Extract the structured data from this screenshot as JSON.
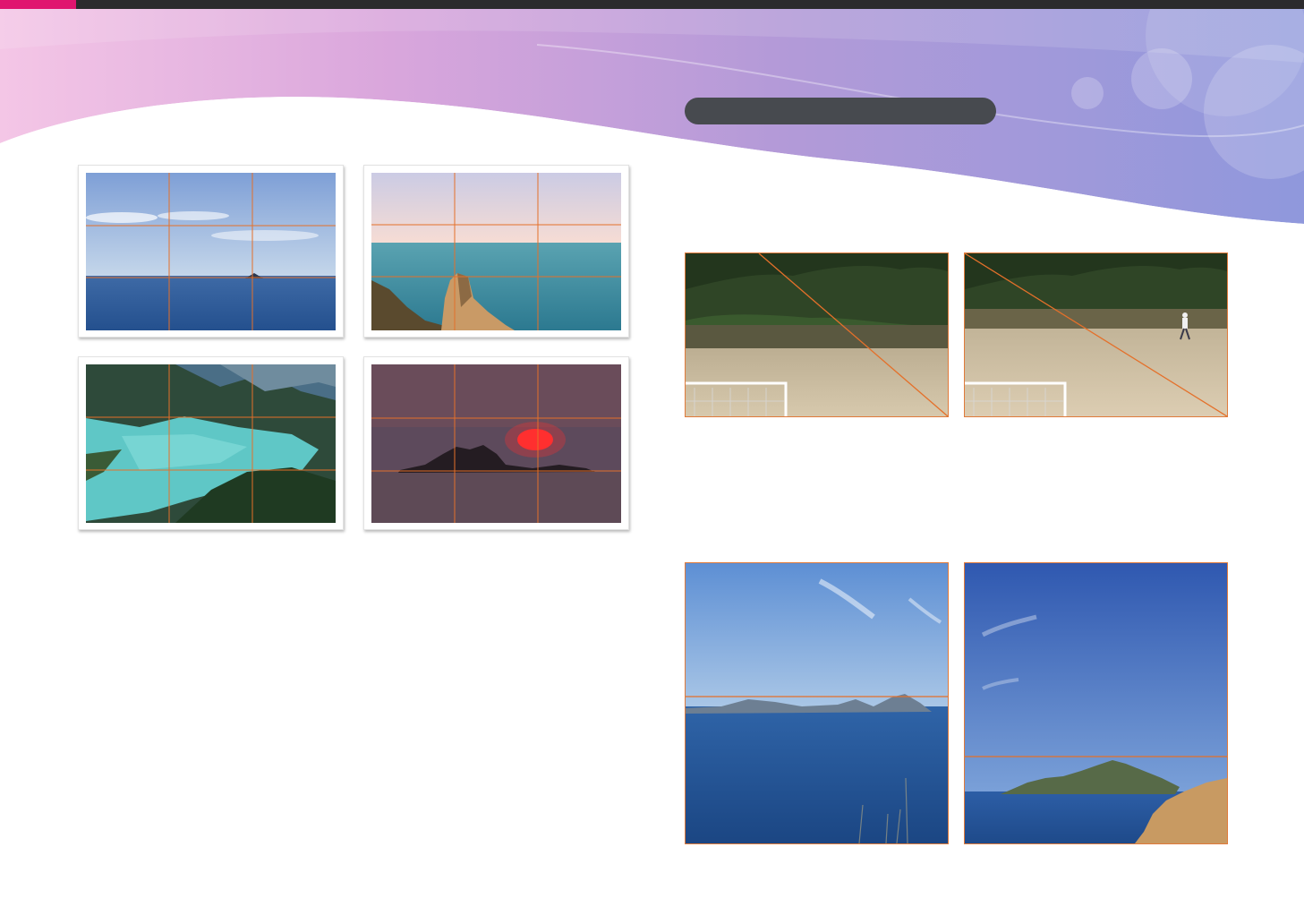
{
  "header": {
    "section_title": ""
  },
  "colors": {
    "accent_bar": "#e0156f",
    "top_bar": "#2b2b2d",
    "pill": "#474a4f",
    "guide_line": "#e07a3a"
  },
  "figures": {
    "grid_examples": [
      "sea-horizon-photo",
      "coastal-cliff-photo",
      "mountain-lake-photo",
      "sunset-island-photo"
    ],
    "diagonal_examples": [
      "soccer-field-diagonal-photo",
      "soccer-field-person-diagonal-photo"
    ],
    "horizon_examples": [
      "sea-horizon-middle-photo",
      "sea-horizon-low-photo"
    ]
  }
}
